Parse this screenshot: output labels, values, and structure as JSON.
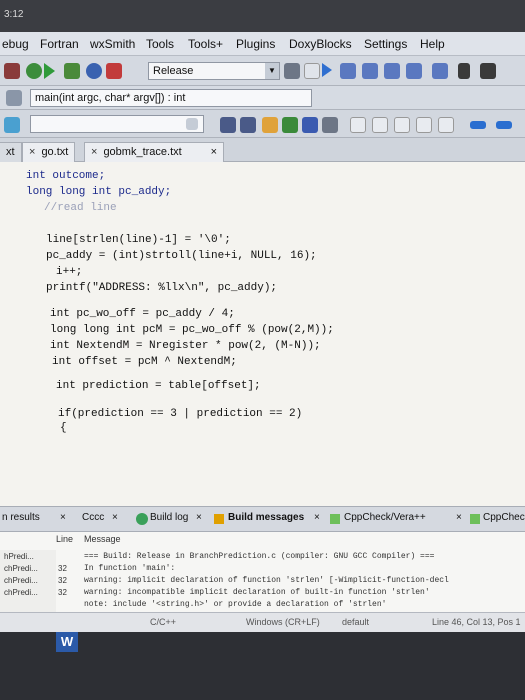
{
  "window": {
    "title": "3:12"
  },
  "menu": [
    "ebug",
    "Fortran",
    "wxSmith",
    "Tools",
    "Tools+",
    "Plugins",
    "DoxyBlocks",
    "Settings",
    "Help"
  ],
  "toolbar": {
    "build_target": "Release"
  },
  "function_combo": "main(int argc, char* argv[]) : int",
  "tabs": [
    "go.txt",
    "gobmk_trace.txt"
  ],
  "tab_prefix": "xt",
  "code_lines": [
    "int outcome;",
    "long long int pc_addy;",
    "//read line",
    "line[strlen(line)-1] = '\\0';",
    "pc_addy = (int)strtoll(line+i, NULL, 16);",
    "i++;",
    "printf(\"ADDRESS: %llx\\n\", pc_addy);",
    "int pc_wo_off = pc_addy / 4;",
    "long long int pcM = pc_wo_off % (pow(2,M));",
    "int NextendM = Nregister * pow(2, (M-N));",
    "int offset = pcM ^ NextendM;",
    "int prediction = table[offset];",
    "if(prediction == 3 | prediction == 2)",
    "{"
  ],
  "bottom_tabs": [
    "n results",
    "Cccc",
    "Build log",
    "Build messages",
    "CppCheck/Vera++",
    "CppCheck/"
  ],
  "log": {
    "columns": [
      "Line",
      "Message"
    ],
    "files": [
      "hPredi...",
      "chPredi...",
      "chPredi...",
      "chPredi..."
    ],
    "line_numbers": [
      "",
      "32",
      "32",
      "32"
    ],
    "lines": [
      "=== Build: Release in BranchPrediction.c (compiler: GNU GCC Compiler) ===",
      "In function 'main':",
      "warning: implicit declaration of function 'strlen' [-Wimplicit-function-decl",
      "warning: incompatible implicit declaration of built-in function 'strlen'",
      "note: include '<string.h>' or provide a declaration of 'strlen'"
    ]
  },
  "status": {
    "language": "C/C++",
    "line_endings": "Windows (CR+LF)",
    "encoding": "default",
    "position": "Line 46, Col 13, Pos 1"
  },
  "taskbar": {
    "app_letter": "W"
  }
}
